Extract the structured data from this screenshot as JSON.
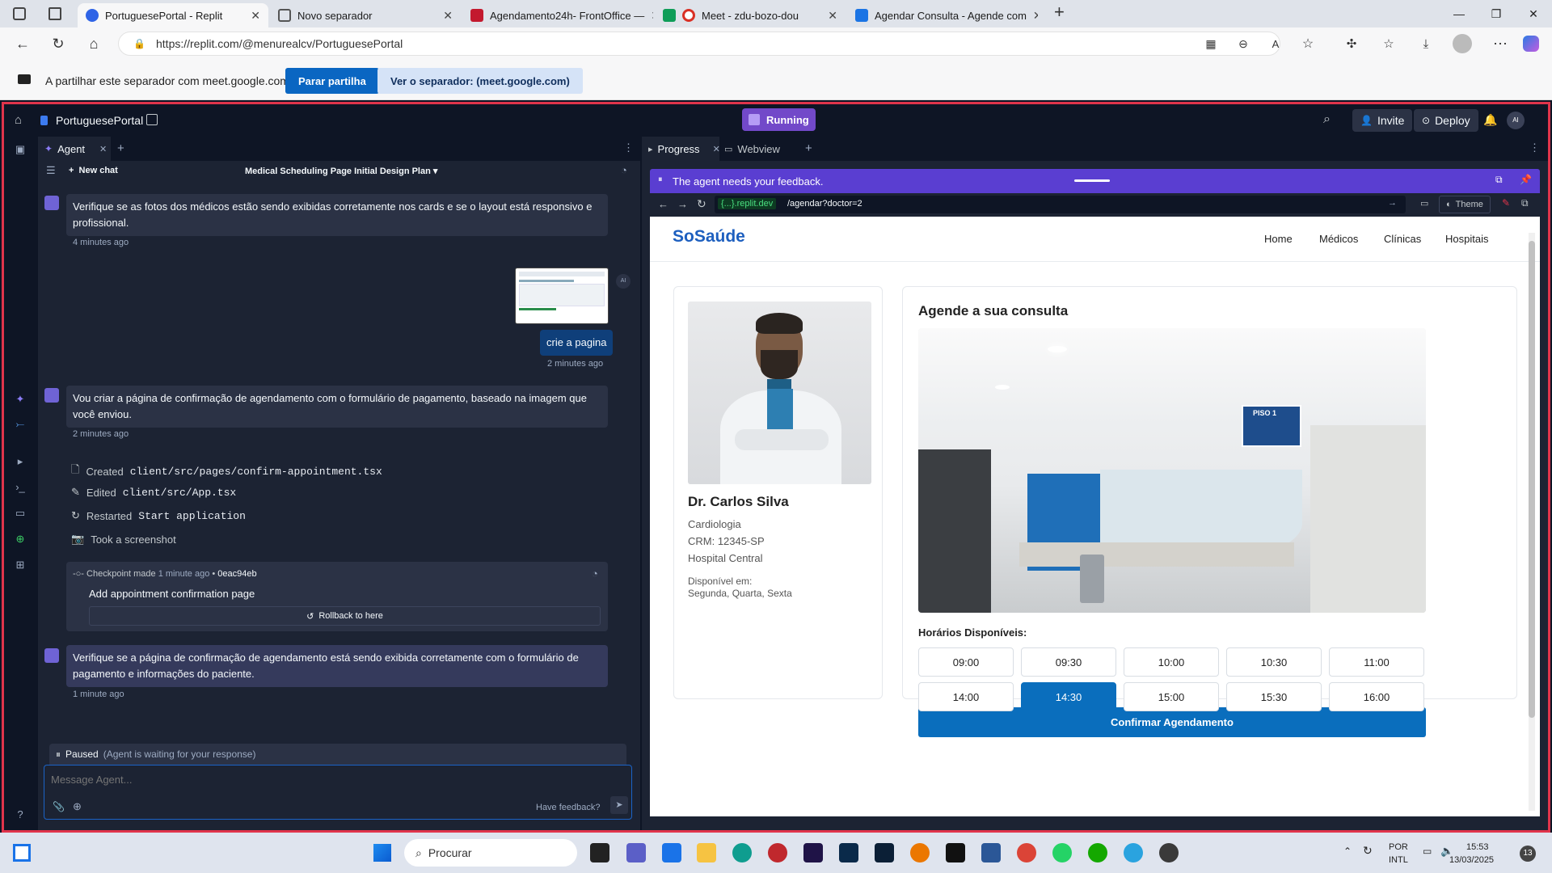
{
  "browser": {
    "tabs": [
      {
        "label": "PortuguesePortal - Replit",
        "color": "#2f64e6"
      },
      {
        "label": "Novo separador",
        "color": "#555"
      },
      {
        "label": "Agendamento24h- FrontOffice —",
        "color": "#c3192e"
      },
      {
        "label": "Meet - zdu-bozo-dou",
        "color": "#d93025"
      },
      {
        "label": "Agendar Consulta - Agende com",
        "color": "#1b74e4"
      }
    ],
    "url": "https://replit.com/@menurealcv/PortuguesePortal"
  },
  "share": {
    "text": "A partilhar este separador com meet.google.com",
    "stop": "Parar partilha",
    "view": "Ver o separador: (meet.google.com)"
  },
  "replit": {
    "project": "PortuguesePortal",
    "status": "Running",
    "invite": "Invite",
    "deploy": "Deploy",
    "avatar": "AI"
  },
  "agent": {
    "tab": "Agent",
    "new_chat": "New chat",
    "chat_title": "Medical Scheduling Page Initial Design Plan",
    "msg1": "Verifique se as fotos dos médicos estão sendo exibidas corretamente nos cards e se o layout está responsivo e profissional.",
    "t1": "4 minutes ago",
    "user_msg": "crie a pagina",
    "t2": "2 minutes ago",
    "msg2": "Vou criar a página de confirmação de agendamento com o formulário de pagamento, baseado na imagem que você enviou.",
    "t3": "2 minutes ago",
    "actions": [
      {
        "verb": "Created",
        "target": "client/src/pages/confirm-appointment.tsx"
      },
      {
        "verb": "Edited",
        "target": "client/src/App.tsx"
      },
      {
        "verb": "Restarted",
        "target": "Start application"
      },
      {
        "verb": "Took a screenshot",
        "target": ""
      }
    ],
    "checkpoint": "Checkpoint made",
    "checkpoint_time": "1 minute ago",
    "checkpoint_hash": "0eac94eb",
    "checkpoint_title": "Add appointment confirmation page",
    "rollback": "Rollback to here",
    "msg3": "Verifique se a página de confirmação de agendamento está sendo exibida corretamente com o formulário de pagamento e informações do paciente.",
    "t4": "1 minute ago",
    "paused": "Paused",
    "paused_sub": "(Agent is waiting for your response)",
    "input_placeholder": "Message Agent...",
    "feedback": "Have feedback?"
  },
  "right": {
    "tab1": "Progress",
    "tab2": "Webview",
    "banner": "The agent needs your feedback.",
    "domain": "{...}.replit.dev",
    "path": "/agendar?doctor=2",
    "theme": "Theme"
  },
  "site": {
    "logo": "SoSaúde",
    "nav": [
      "Home",
      "Médicos",
      "Clínicas",
      "Hospitais"
    ],
    "doctor": "Dr. Carlos Silva",
    "specialty": "Cardiologia",
    "crm": "CRM: 12345-SP",
    "hospital": "Hospital Central",
    "avail_label": "Disponível em:",
    "avail_days": "Segunda, Quarta, Sexta",
    "heading": "Agende a sua consulta",
    "sign_title": "PISO 1",
    "times_label": "Horários Disponíveis:",
    "times": [
      "09:00",
      "09:30",
      "10:00",
      "10:30",
      "11:00",
      "14:00",
      "14:30",
      "15:00",
      "15:30",
      "16:00"
    ],
    "selected": "14:30",
    "confirm": "Confirmar Agendamento"
  },
  "taskbar": {
    "search": "Procurar",
    "lang1": "POR",
    "lang2": "INTL",
    "time": "15:53",
    "date": "13/03/2025",
    "badge": "13"
  }
}
